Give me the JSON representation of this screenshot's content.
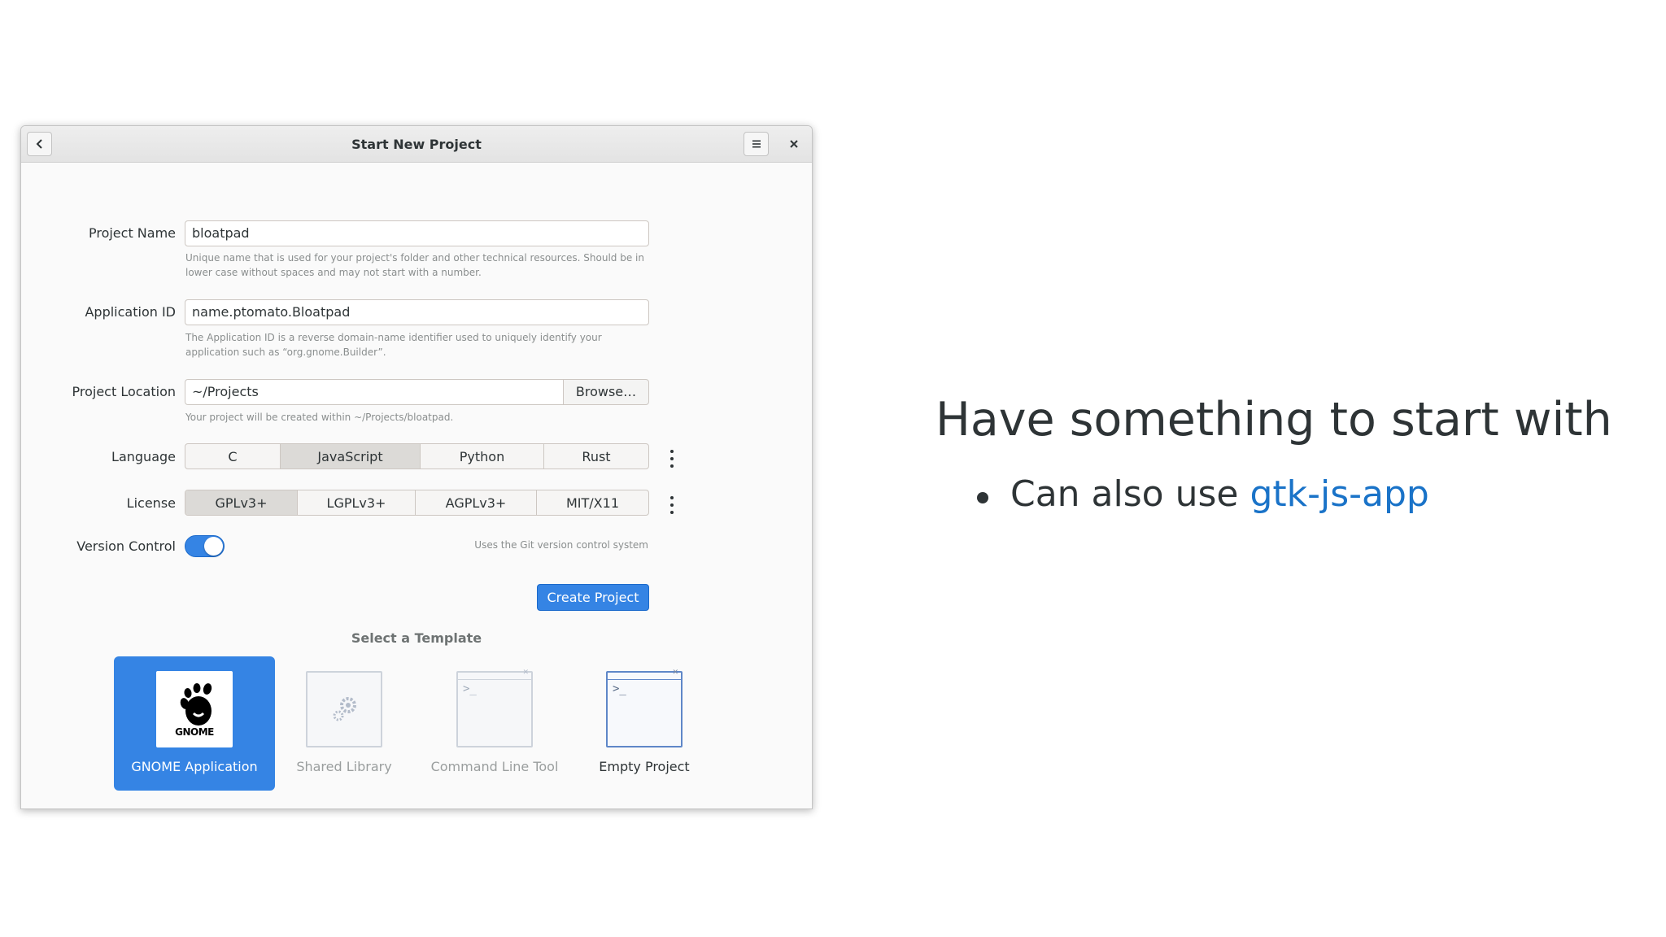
{
  "window": {
    "title": "Start New Project"
  },
  "form": {
    "project_name": {
      "label": "Project Name",
      "value": "bloatpad",
      "help_line1": "Unique name that is used for your project's folder and other technical resources. Should be in",
      "help_line2": "lower case without spaces and may not start with a number."
    },
    "application_id": {
      "label": "Application ID",
      "value": "name.ptomato.Bloatpad",
      "help_line1": "The Application ID is a reverse domain-name identifier used to uniquely identify your",
      "help_line2": "application such as “org.gnome.Builder”."
    },
    "project_location": {
      "label": "Project Location",
      "value": "~/Projects",
      "browse_label": "Browse…",
      "help": "Your project will be created within ~/Projects/bloatpad."
    },
    "language": {
      "label": "Language",
      "options": [
        "C",
        "JavaScript",
        "Python",
        "Rust"
      ],
      "selected": "JavaScript"
    },
    "license": {
      "label": "License",
      "options": [
        "GPLv3+",
        "LGPLv3+",
        "AGPLv3+",
        "MIT/X11"
      ],
      "selected": "GPLv3+"
    },
    "version_control": {
      "label": "Version Control",
      "enabled": true,
      "help": "Uses the Git version control system"
    },
    "create_button": "Create Project"
  },
  "templates": {
    "title": "Select a Template",
    "items": [
      {
        "label": "GNOME Application",
        "icon": "gnome-logo-icon",
        "logo_text": "GNOME",
        "state": "selected"
      },
      {
        "label": "Shared Library",
        "icon": "gear-icon",
        "state": "disabled"
      },
      {
        "label": "Command Line Tool",
        "icon": "terminal-icon",
        "state": "disabled"
      },
      {
        "label": "Empty Project",
        "icon": "terminal-icon",
        "state": "normal"
      }
    ]
  },
  "slide": {
    "title": "Have something to start with",
    "bullet_prefix": "Can also use ",
    "bullet_link": "gtk-js-app"
  },
  "colors": {
    "accent": "#3584e4",
    "link": "#1a73c8"
  }
}
